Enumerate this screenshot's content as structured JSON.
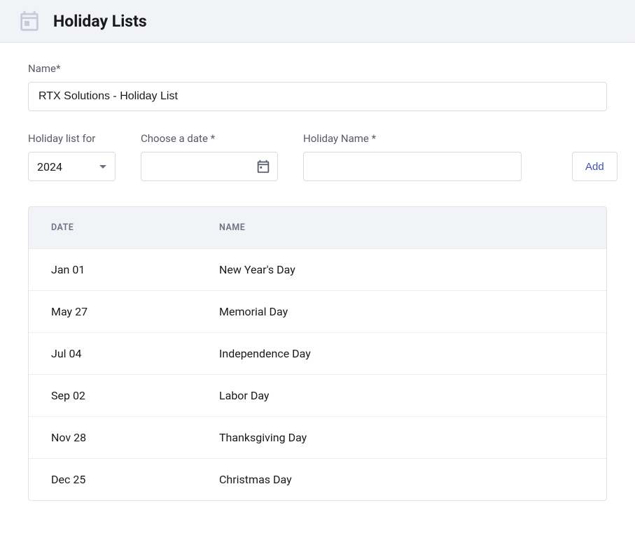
{
  "header": {
    "title": "Holiday Lists"
  },
  "form": {
    "name_label": "Name*",
    "name_value": "RTX Solutions - Holiday List",
    "year_label": "Holiday list for",
    "year_value": "2024",
    "date_label": "Choose a date *",
    "date_value": "",
    "holiday_name_label": "Holiday Name *",
    "holiday_name_value": "",
    "add_label": "Add"
  },
  "table": {
    "headers": {
      "date": "DATE",
      "name": "NAME"
    },
    "rows": [
      {
        "date": "Jan 01",
        "name": "New Year's Day"
      },
      {
        "date": "May 27",
        "name": "Memorial Day"
      },
      {
        "date": "Jul 04",
        "name": "Independence Day"
      },
      {
        "date": "Sep 02",
        "name": "Labor Day"
      },
      {
        "date": "Nov 28",
        "name": "Thanksgiving Day"
      },
      {
        "date": "Dec 25",
        "name": "Christmas Day"
      }
    ]
  }
}
